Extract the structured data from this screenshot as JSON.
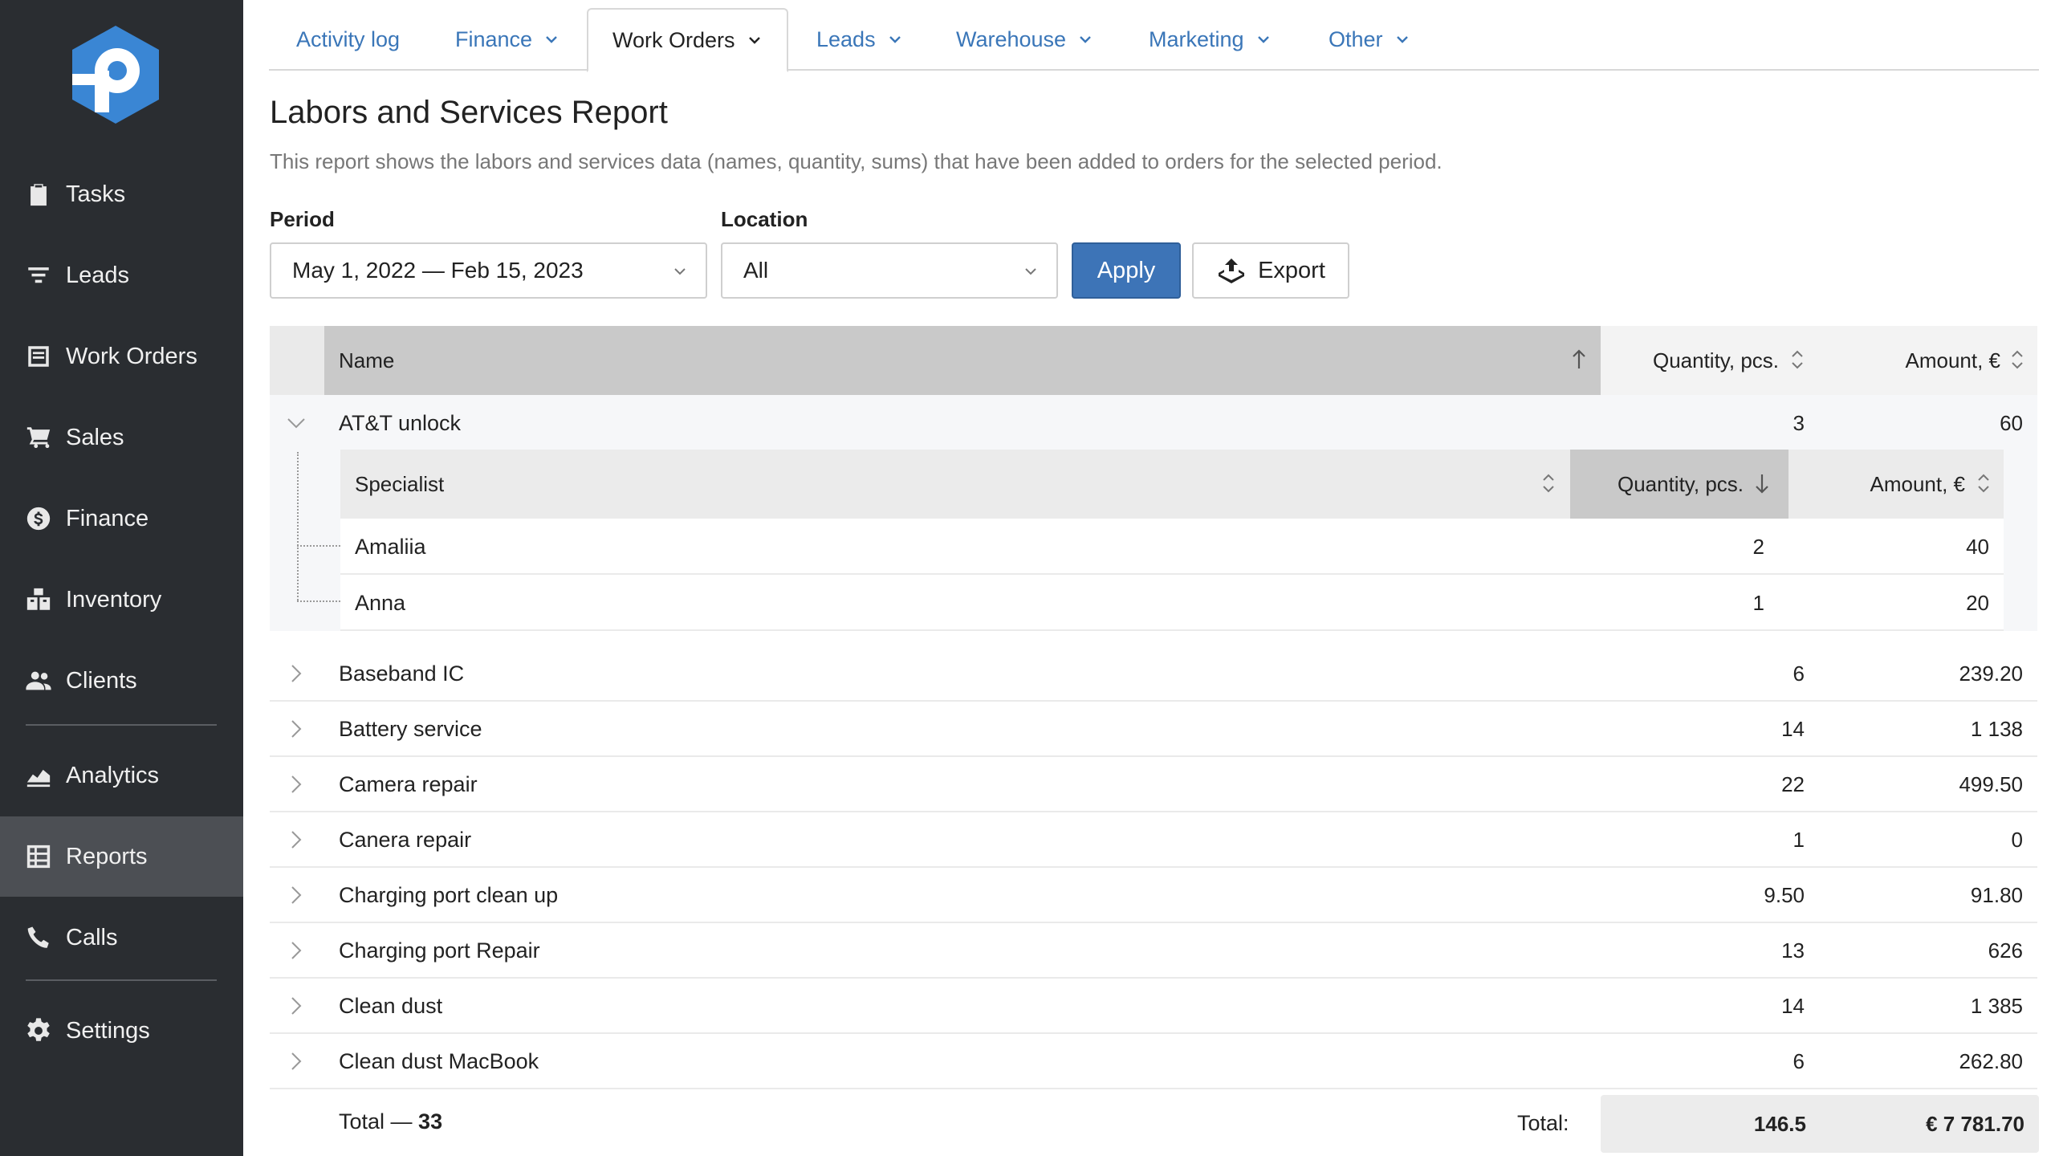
{
  "sidebar": {
    "logo": "p-logo-icon",
    "items": [
      {
        "label": "Tasks",
        "icon": "clipboard-check-icon"
      },
      {
        "label": "Leads",
        "icon": "funnel-icon"
      },
      {
        "label": "Work Orders",
        "icon": "work-order-icon"
      },
      {
        "label": "Sales",
        "icon": "cart-icon"
      },
      {
        "label": "Finance",
        "icon": "dollar-coin-icon"
      },
      {
        "label": "Inventory",
        "icon": "boxes-icon"
      },
      {
        "label": "Clients",
        "icon": "users-icon"
      },
      {
        "label": "Analytics",
        "icon": "area-chart-icon"
      },
      {
        "label": "Reports",
        "icon": "report-grid-icon",
        "active": true
      },
      {
        "label": "Calls",
        "icon": "phone-icon"
      },
      {
        "label": "Settings",
        "icon": "gear-icon"
      }
    ]
  },
  "tabs": [
    {
      "label": "Activity log"
    },
    {
      "label": "Finance"
    },
    {
      "label": "Work Orders",
      "active": true
    },
    {
      "label": "Leads"
    },
    {
      "label": "Warehouse"
    },
    {
      "label": "Marketing"
    },
    {
      "label": "Other"
    }
  ],
  "page": {
    "title": "Labors and Services Report",
    "description": "This report shows the labors and services data (names, quantity, sums) that have been added to orders for the selected period."
  },
  "filters": {
    "period_label": "Period",
    "period_value": "May 1, 2022 — Feb 15, 2023",
    "location_label": "Location",
    "location_value": "All",
    "apply_label": "Apply",
    "export_label": "Export"
  },
  "table": {
    "columns": {
      "name": "Name",
      "quantity": "Quantity, pcs.",
      "amount": "Amount, €"
    },
    "expanded": {
      "name": "AT&T unlock",
      "quantity": "3",
      "amount": "60",
      "sub_columns": {
        "specialist": "Specialist",
        "quantity": "Quantity, pcs.",
        "amount": "Amount, €"
      },
      "sub_rows": [
        {
          "name": "Amaliia",
          "quantity": "2",
          "amount": "40"
        },
        {
          "name": "Anna",
          "quantity": "1",
          "amount": "20"
        }
      ]
    },
    "rows": [
      {
        "name": "Baseband IC",
        "quantity": "6",
        "amount": "239.20"
      },
      {
        "name": "Battery service",
        "quantity": "14",
        "amount": "1 138"
      },
      {
        "name": "Camera repair",
        "quantity": "22",
        "amount": "499.50"
      },
      {
        "name": "Canera repair",
        "quantity": "1",
        "amount": "0"
      },
      {
        "name": "Charging port clean up",
        "quantity": "9.50",
        "amount": "91.80"
      },
      {
        "name": "Charging port Repair",
        "quantity": "13",
        "amount": "626"
      },
      {
        "name": "Clean dust",
        "quantity": "14",
        "amount": "1 385"
      },
      {
        "name": "Clean dust MacBook",
        "quantity": "6",
        "amount": "262.80"
      }
    ],
    "footer": {
      "total_prefix": "Total — ",
      "total_count": "33",
      "total_label": "Total:",
      "total_quantity": "146.5",
      "total_amount": "€ 7 781.70"
    }
  },
  "colors": {
    "sidebar_bg": "#2a2d31",
    "accent": "#3d74b7",
    "link": "#3a76b8",
    "logo": "#3a86d4"
  }
}
